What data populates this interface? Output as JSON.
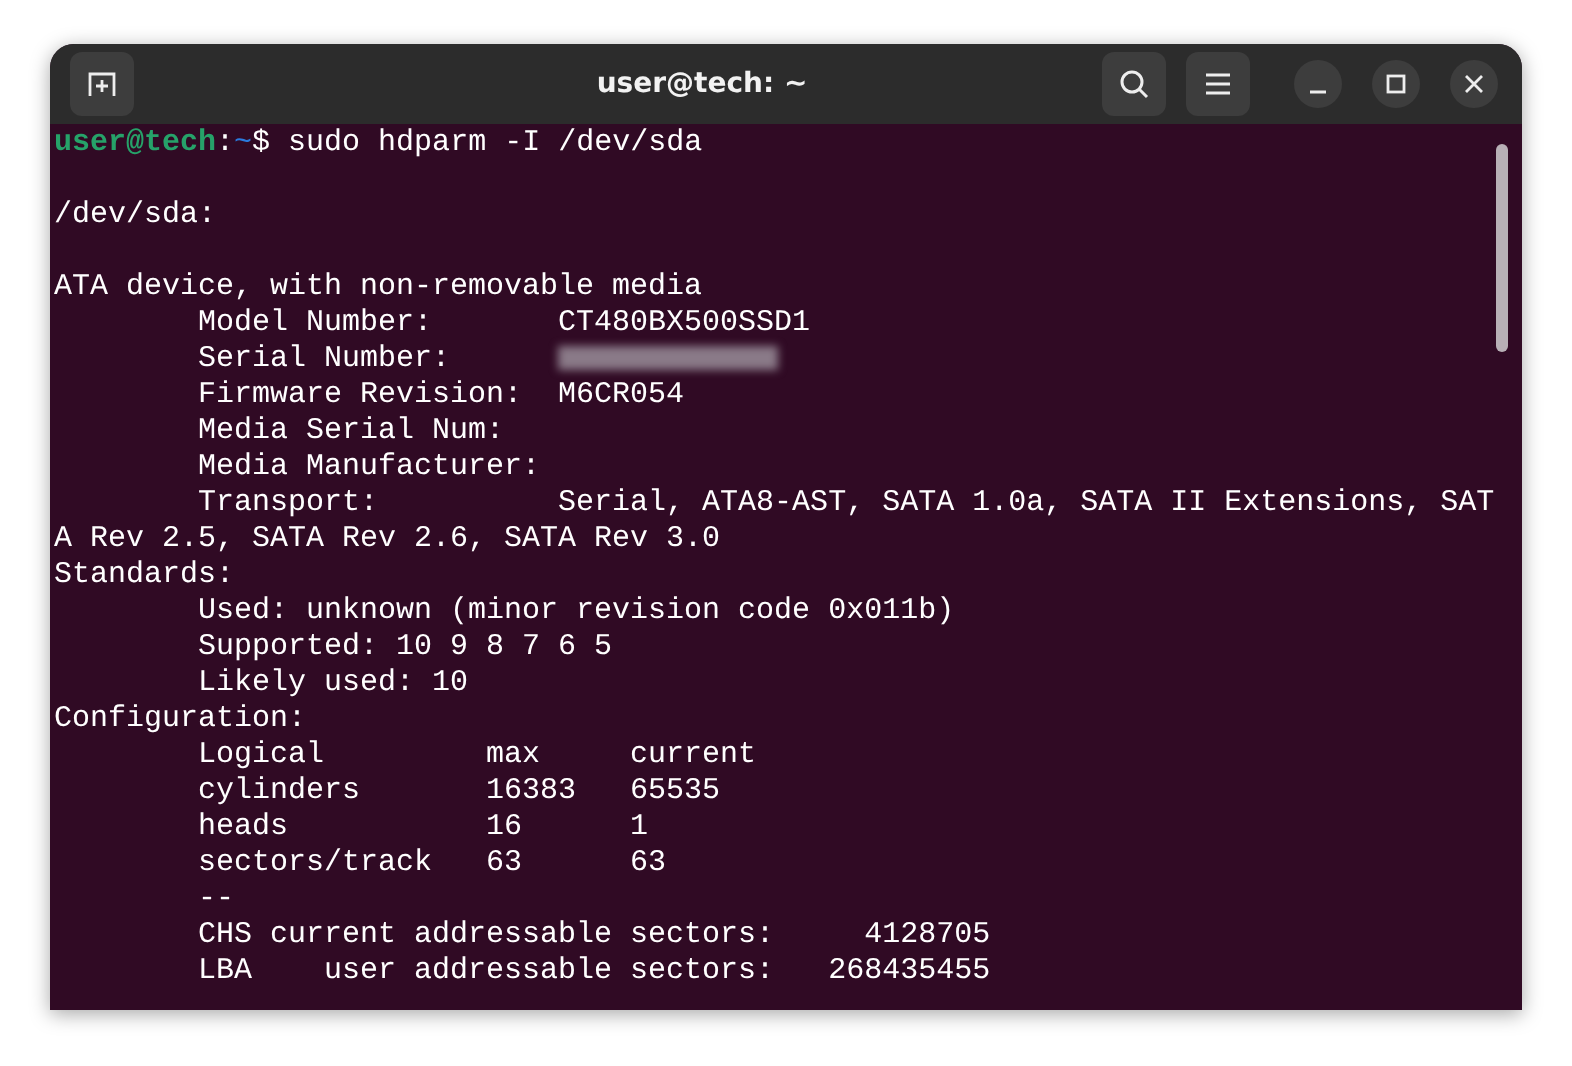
{
  "window": {
    "title": "user@tech: ~"
  },
  "prompt": {
    "user": "user@tech",
    "separator": ":",
    "path": "~",
    "symbol": "$",
    "command": "sudo hdparm -I /dev/sda"
  },
  "lines": [
    {
      "kind": "blank"
    },
    {
      "kind": "text",
      "text": "/dev/sda:"
    },
    {
      "kind": "blank"
    },
    {
      "kind": "text",
      "text": "ATA device, with non-removable media"
    },
    {
      "kind": "text",
      "text": "        Model Number:       CT480BX500SSD1"
    },
    {
      "kind": "redacted",
      "text": "        Serial Number:"
    },
    {
      "kind": "text",
      "text": "        Firmware Revision:  M6CR054"
    },
    {
      "kind": "text",
      "text": "        Media Serial Num:"
    },
    {
      "kind": "text",
      "text": "        Media Manufacturer:"
    },
    {
      "kind": "text",
      "text": "        Transport:          Serial, ATA8-AST, SATA 1.0a, SATA II Extensions, SAT"
    },
    {
      "kind": "text",
      "text": "A Rev 2.5, SATA Rev 2.6, SATA Rev 3.0"
    },
    {
      "kind": "text",
      "text": "Standards:"
    },
    {
      "kind": "text",
      "text": "        Used: unknown (minor revision code 0x011b)"
    },
    {
      "kind": "text",
      "text": "        Supported: 10 9 8 7 6 5"
    },
    {
      "kind": "text",
      "text": "        Likely used: 10"
    },
    {
      "kind": "text",
      "text": "Configuration:"
    },
    {
      "kind": "text",
      "text": "        Logical         max     current"
    },
    {
      "kind": "text",
      "text": "        cylinders       16383   65535"
    },
    {
      "kind": "text",
      "text": "        heads           16      1"
    },
    {
      "kind": "text",
      "text": "        sectors/track   63      63"
    },
    {
      "kind": "text",
      "text": "        --"
    },
    {
      "kind": "text",
      "text": "        CHS current addressable sectors:     4128705"
    },
    {
      "kind": "text",
      "text": "        LBA    user addressable sectors:   268435455"
    }
  ]
}
